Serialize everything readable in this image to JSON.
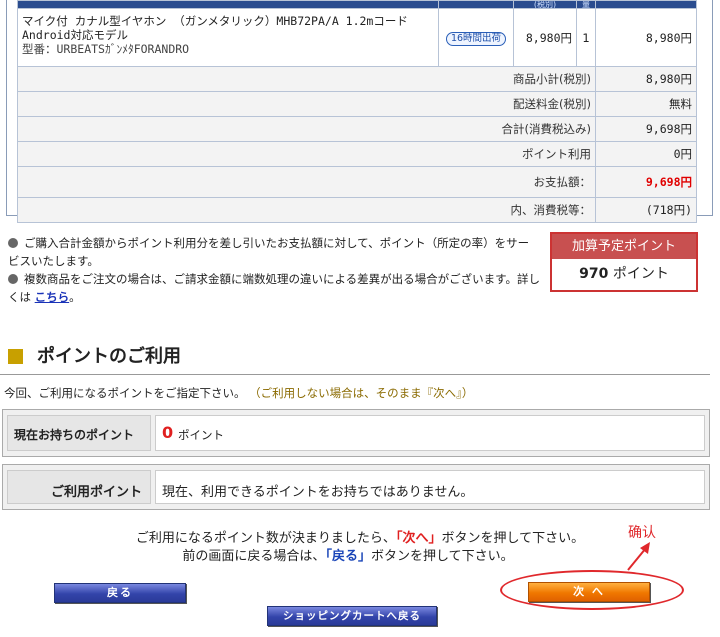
{
  "table_header": {
    "unit_price": "(税別)",
    "qty": "量"
  },
  "order_item": {
    "name": "マイク付 カナル型イヤホン （ガンメタリック）MHB72PA/A 1.2mコード",
    "subtitle": "Android対応モデル",
    "model": "型番：URBEATSｶﾞﾝﾒﾀFORANDRO",
    "ship_badge": "16時間出荷",
    "unit_price": "8,980円",
    "qty": "1",
    "amount": "8,980円"
  },
  "summary": [
    {
      "label": "商品小計(税別)",
      "value": "8,980円"
    },
    {
      "label": "配送料金(税別)",
      "value": "無料"
    },
    {
      "label": "合計(消費税込み)",
      "value": "9,698円"
    },
    {
      "label": "ポイント利用",
      "value": "0円"
    }
  ],
  "total_label": "お支払額：",
  "total_value": "9,698円",
  "tax_label": "内、消費税等：",
  "tax_value": "(718円)",
  "notes": {
    "note1": "ご購入合計金額からポイント利用分を差し引いたお支払額に対して、ポイント（所定の率）をサービスいたします。",
    "note2": "複数商品をご注文の場合は、ご請求金額に端数処理の違いによる差異が出る場合がございます。詳しくは",
    "note2_link": "こちら",
    "note2_end": "。"
  },
  "points_box": {
    "title": "加算予定ポイント",
    "value": "970",
    "unit": "ポイント"
  },
  "section_title": "ポイントのご利用",
  "intro": "今回、ご利用になるポイントをご指定下さい。",
  "intro_sub": "（ご利用しない場合は、そのまま『次へ』）",
  "current_points": {
    "label": "現在お持ちのポイント",
    "value": "0",
    "unit": "ポイント"
  },
  "use_points": {
    "label": "ご利用ポイント",
    "value": "現在、利用できるポイントをお持ちではありません。"
  },
  "guide": {
    "line1_a": "ご利用になるポイント数が決まりましたら、",
    "line1_btn": "「次へ」",
    "line1_b": "ボタンを押して下さい。",
    "line2_a": "前の画面に戻る場合は、",
    "line2_btn": "「戻る」",
    "line2_b": "ボタンを押して下さい。"
  },
  "buttons": {
    "back": "戻る",
    "next": "次 へ",
    "cart": "ショッピングカートへ戻る"
  },
  "annotation": {
    "text": "确认",
    "color": "#e0282c"
  }
}
